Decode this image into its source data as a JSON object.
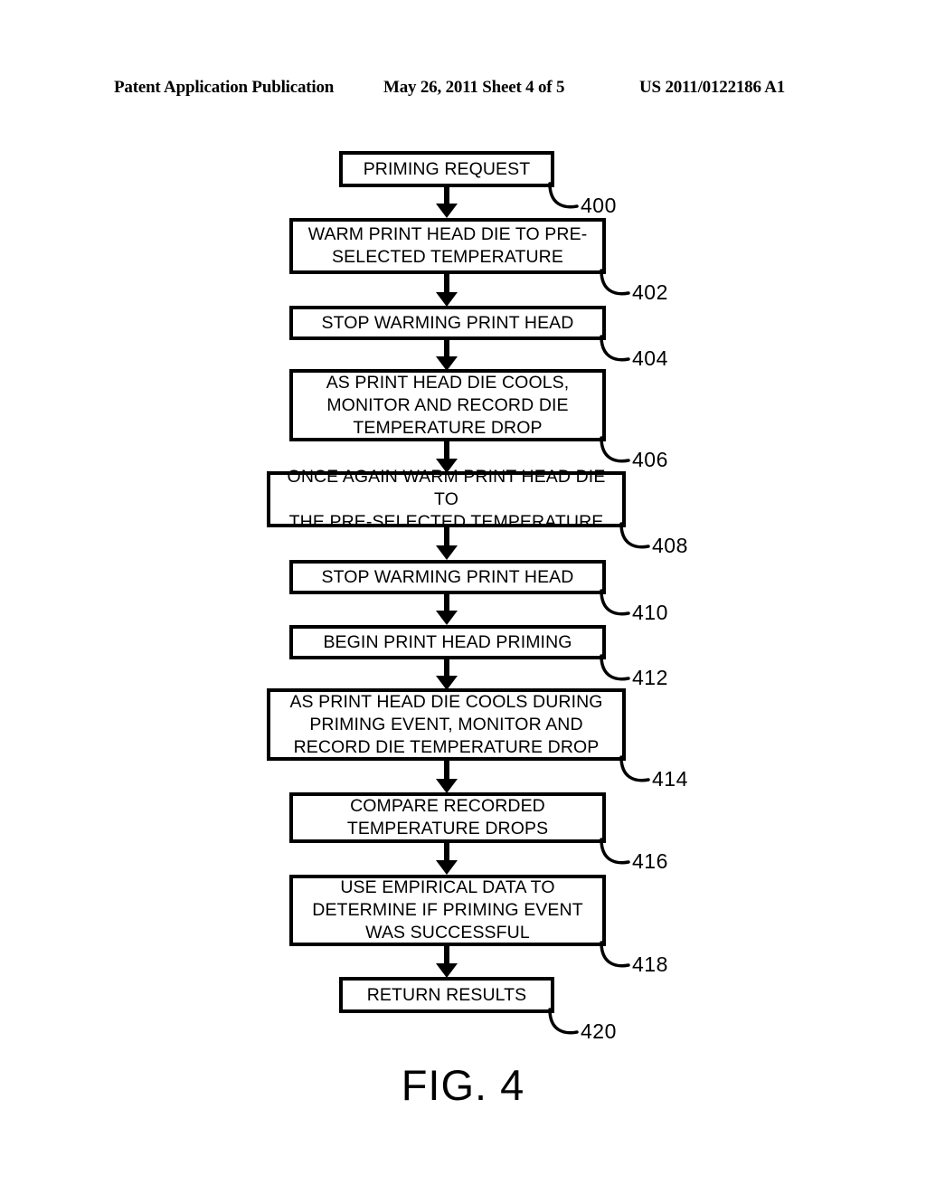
{
  "header": {
    "left": "Patent Application Publication",
    "middle": "May 26, 2011  Sheet 4 of 5",
    "right": "US 2011/0122186 A1"
  },
  "figure": {
    "caption": "FIG. 4",
    "type": "flowchart"
  },
  "flowchart": {
    "nodes": [
      {
        "ref": "400",
        "text": "PRIMING REQUEST"
      },
      {
        "ref": "402",
        "text": "WARM PRINT HEAD DIE TO PRE-\nSELECTED TEMPERATURE"
      },
      {
        "ref": "404",
        "text": "STOP WARMING PRINT HEAD"
      },
      {
        "ref": "406",
        "text": "AS PRINT HEAD DIE COOLS,\nMONITOR AND RECORD DIE\nTEMPERATURE DROP"
      },
      {
        "ref": "408",
        "text": "ONCE AGAIN WARM PRINT HEAD DIE TO\nTHE PRE-SELECTED TEMPERATURE"
      },
      {
        "ref": "410",
        "text": "STOP WARMING PRINT HEAD"
      },
      {
        "ref": "412",
        "text": "BEGIN PRINT HEAD PRIMING"
      },
      {
        "ref": "414",
        "text": "AS PRINT HEAD DIE COOLS DURING\nPRIMING EVENT, MONITOR AND\nRECORD DIE TEMPERATURE DROP"
      },
      {
        "ref": "416",
        "text": "COMPARE RECORDED\nTEMPERATURE DROPS"
      },
      {
        "ref": "418",
        "text": "USE EMPIRICAL DATA TO\nDETERMINE IF PRIMING EVENT\nWAS SUCCESSFUL"
      },
      {
        "ref": "420",
        "text": "RETURN RESULTS"
      }
    ]
  }
}
